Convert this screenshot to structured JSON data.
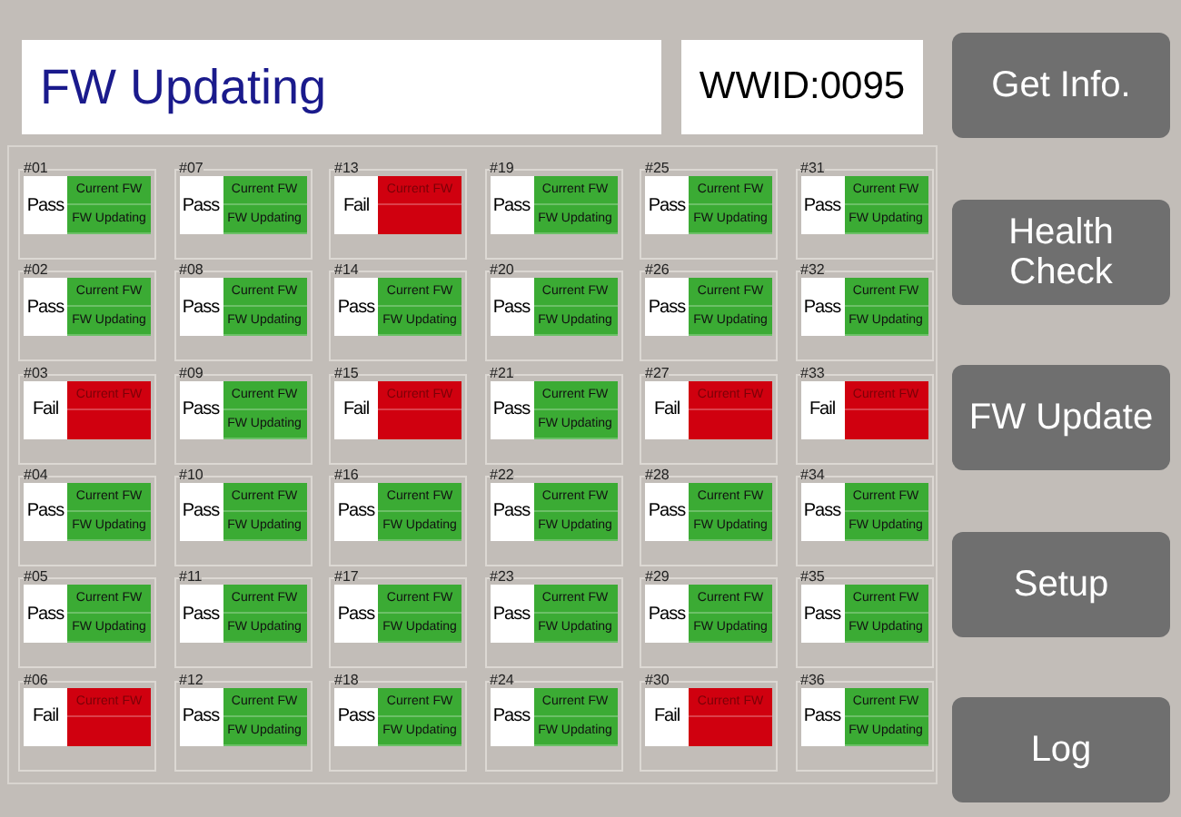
{
  "title": "FW Updating",
  "wwid": "WWID:0095",
  "slots": [
    {
      "id": "#01",
      "result": "Pass",
      "failed": false,
      "lines": [
        "Current FW",
        "FW Updating"
      ]
    },
    {
      "id": "#02",
      "result": "Pass",
      "failed": false,
      "lines": [
        "Current FW",
        "FW Updating"
      ]
    },
    {
      "id": "#03",
      "result": "Fail",
      "failed": true,
      "lines": [
        "Current FW"
      ]
    },
    {
      "id": "#04",
      "result": "Pass",
      "failed": false,
      "lines": [
        "Current FW",
        "FW Updating"
      ]
    },
    {
      "id": "#05",
      "result": "Pass",
      "failed": false,
      "lines": [
        "Current FW",
        "FW Updating"
      ]
    },
    {
      "id": "#06",
      "result": "Fail",
      "failed": true,
      "lines": [
        "Current FW"
      ]
    },
    {
      "id": "#07",
      "result": "Pass",
      "failed": false,
      "lines": [
        "Current FW",
        "FW Updating"
      ]
    },
    {
      "id": "#08",
      "result": "Pass",
      "failed": false,
      "lines": [
        "Current FW",
        "FW Updating"
      ]
    },
    {
      "id": "#09",
      "result": "Pass",
      "failed": false,
      "lines": [
        "Current FW",
        "FW Updating"
      ]
    },
    {
      "id": "#10",
      "result": "Pass",
      "failed": false,
      "lines": [
        "Current FW",
        "FW Updating"
      ]
    },
    {
      "id": "#11",
      "result": "Pass",
      "failed": false,
      "lines": [
        "Current FW",
        "FW Updating"
      ]
    },
    {
      "id": "#12",
      "result": "Pass",
      "failed": false,
      "lines": [
        "Current FW",
        "FW Updating"
      ]
    },
    {
      "id": "#13",
      "result": "Fail",
      "failed": true,
      "lines": [
        "Current FW"
      ]
    },
    {
      "id": "#14",
      "result": "Pass",
      "failed": false,
      "lines": [
        "Current FW",
        "FW Updating"
      ]
    },
    {
      "id": "#15",
      "result": "Fail",
      "failed": true,
      "lines": [
        "Current FW"
      ]
    },
    {
      "id": "#16",
      "result": "Pass",
      "failed": false,
      "lines": [
        "Current FW",
        "FW Updating"
      ]
    },
    {
      "id": "#17",
      "result": "Pass",
      "failed": false,
      "lines": [
        "Current FW",
        "FW Updating"
      ]
    },
    {
      "id": "#18",
      "result": "Pass",
      "failed": false,
      "lines": [
        "Current FW",
        "FW Updating"
      ]
    },
    {
      "id": "#19",
      "result": "Pass",
      "failed": false,
      "lines": [
        "Current FW",
        "FW Updating"
      ]
    },
    {
      "id": "#20",
      "result": "Pass",
      "failed": false,
      "lines": [
        "Current FW",
        "FW Updating"
      ]
    },
    {
      "id": "#21",
      "result": "Pass",
      "failed": false,
      "lines": [
        "Current FW",
        "FW Updating"
      ]
    },
    {
      "id": "#22",
      "result": "Pass",
      "failed": false,
      "lines": [
        "Current FW",
        "FW Updating"
      ]
    },
    {
      "id": "#23",
      "result": "Pass",
      "failed": false,
      "lines": [
        "Current FW",
        "FW Updating"
      ]
    },
    {
      "id": "#24",
      "result": "Pass",
      "failed": false,
      "lines": [
        "Current FW",
        "FW Updating"
      ]
    },
    {
      "id": "#25",
      "result": "Pass",
      "failed": false,
      "lines": [
        "Current FW",
        "FW Updating"
      ]
    },
    {
      "id": "#26",
      "result": "Pass",
      "failed": false,
      "lines": [
        "Current FW",
        "FW Updating"
      ]
    },
    {
      "id": "#27",
      "result": "Fail",
      "failed": true,
      "lines": [
        "Current FW"
      ]
    },
    {
      "id": "#28",
      "result": "Pass",
      "failed": false,
      "lines": [
        "Current FW",
        "FW Updating"
      ]
    },
    {
      "id": "#29",
      "result": "Pass",
      "failed": false,
      "lines": [
        "Current FW",
        "FW Updating"
      ]
    },
    {
      "id": "#30",
      "result": "Fail",
      "failed": true,
      "lines": [
        "Current FW"
      ]
    },
    {
      "id": "#31",
      "result": "Pass",
      "failed": false,
      "lines": [
        "Current FW",
        "FW Updating"
      ]
    },
    {
      "id": "#32",
      "result": "Pass",
      "failed": false,
      "lines": [
        "Current FW",
        "FW Updating"
      ]
    },
    {
      "id": "#33",
      "result": "Fail",
      "failed": true,
      "lines": [
        "Current FW"
      ]
    },
    {
      "id": "#34",
      "result": "Pass",
      "failed": false,
      "lines": [
        "Current FW",
        "FW Updating"
      ]
    },
    {
      "id": "#35",
      "result": "Pass",
      "failed": false,
      "lines": [
        "Current FW",
        "FW Updating"
      ]
    },
    {
      "id": "#36",
      "result": "Pass",
      "failed": false,
      "lines": [
        "Current FW",
        "FW Updating"
      ]
    }
  ],
  "buttons": [
    {
      "label": "Get Info."
    },
    {
      "label": "Health Check"
    },
    {
      "label": "FW Update"
    },
    {
      "label": "Setup"
    },
    {
      "label": "Log"
    }
  ]
}
